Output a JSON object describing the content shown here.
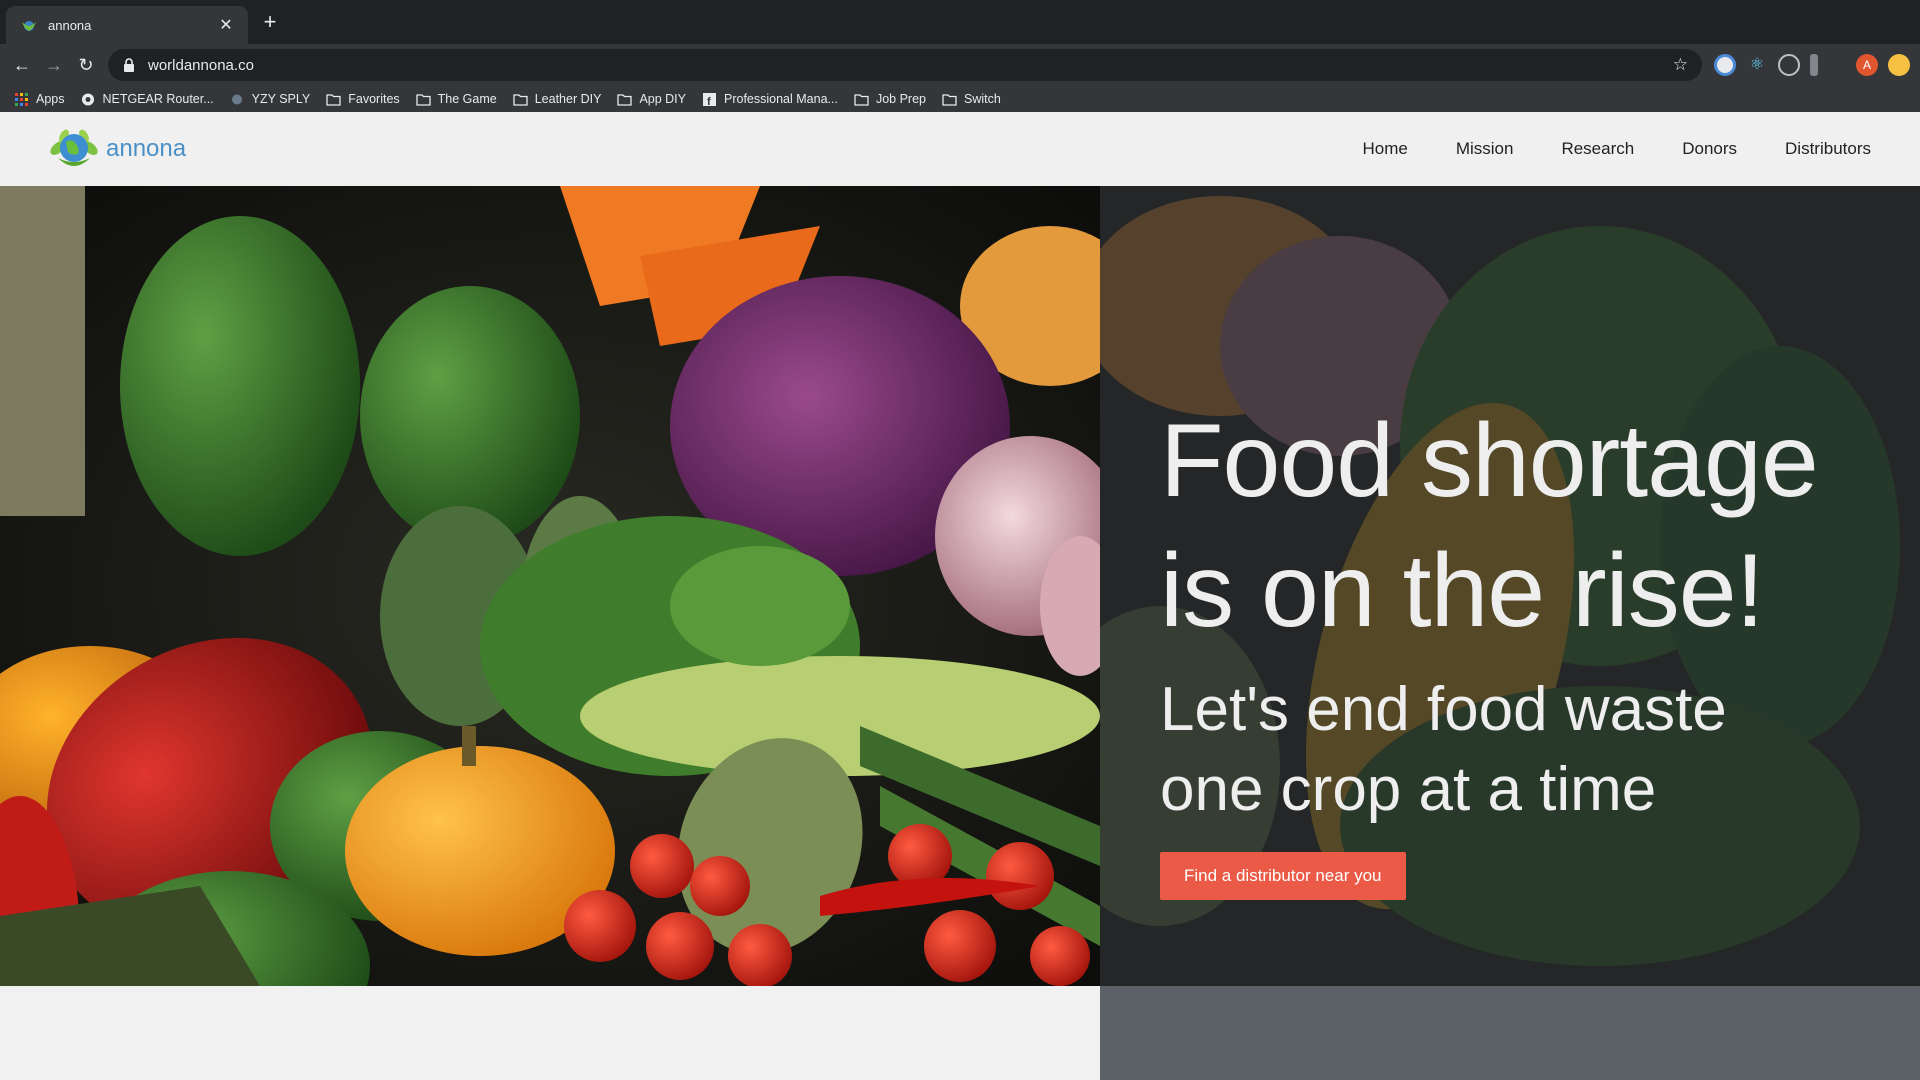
{
  "browser": {
    "tab_title": "annona",
    "url": "worldannona.co",
    "bookmarks": [
      {
        "label": "Apps",
        "icon": "apps-grid-icon"
      },
      {
        "label": "NETGEAR Router...",
        "icon": "netgear-icon"
      },
      {
        "label": "YZY SPLY",
        "icon": "yzy-icon"
      },
      {
        "label": "Favorites",
        "icon": "folder-icon"
      },
      {
        "label": "The Game",
        "icon": "folder-icon"
      },
      {
        "label": "Leather DIY",
        "icon": "folder-icon"
      },
      {
        "label": "App DIY",
        "icon": "folder-icon"
      },
      {
        "label": "Professional Mana...",
        "icon": "facebook-icon"
      },
      {
        "label": "Job Prep",
        "icon": "folder-icon"
      },
      {
        "label": "Switch",
        "icon": "folder-icon"
      }
    ],
    "profile_initial": "A"
  },
  "site": {
    "logo_text": "annona",
    "nav": [
      "Home",
      "Mission",
      "Research",
      "Donors",
      "Distributors"
    ]
  },
  "hero": {
    "title_line1": "Food shortage",
    "title_line2": "is on the rise!",
    "subtitle_line1": "Let's end food waste",
    "subtitle_line2": "one crop at a time",
    "cta_label": "Find a distributor near you"
  },
  "colors": {
    "accent": "#eb5a46",
    "logo_blue": "#4a90c8",
    "chrome_dark": "#202124",
    "chrome_mid": "#35363a"
  }
}
